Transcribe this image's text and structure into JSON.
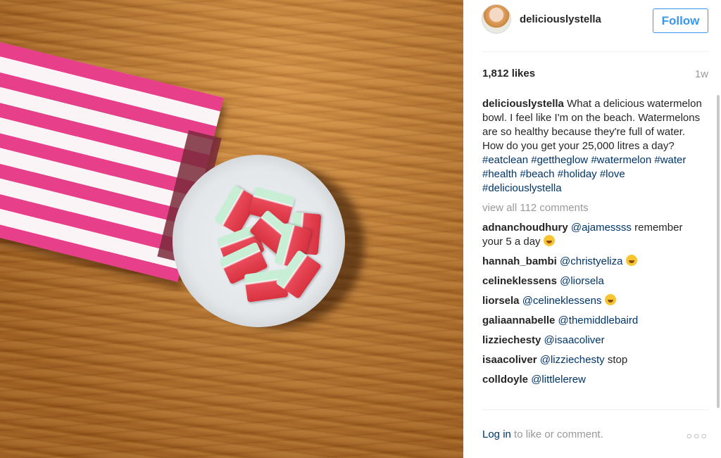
{
  "post": {
    "username": "deliciouslystella",
    "follow_label": "Follow",
    "likes": "1,812 likes",
    "age": "1w"
  },
  "caption": {
    "username": "deliciouslystella",
    "text": "What a delicious watermelon bowl. I feel like I'm on the beach. Watermelons are so healthy because they're full of water. How do you get your 25,000 litres a day?",
    "hashtags": [
      "#eatclean",
      "#gettheglow",
      "#watermelon",
      "#water",
      "#health",
      "#beach",
      "#holiday",
      "#love",
      "#deliciouslystella"
    ]
  },
  "view_all": "view all 112 comments",
  "comments": [
    {
      "user": "adnanchoudhury",
      "mention": "@ajamessss",
      "text": "remember your 5 a day",
      "emoji": "laughing-tears"
    },
    {
      "user": "hannah_bambi",
      "mention": "@christyeliza",
      "text": "",
      "emoji": "laughing-tears"
    },
    {
      "user": "celineklessens",
      "mention": "@liorsela",
      "text": "",
      "emoji": ""
    },
    {
      "user": "liorsela",
      "mention": "@celineklessens",
      "text": "",
      "emoji": "laughing-tears"
    },
    {
      "user": "galiaannabelle",
      "mention": "@themiddlebaird",
      "text": "",
      "emoji": ""
    },
    {
      "user": "lizziechesty",
      "mention": "@isaacoliver",
      "text": "",
      "emoji": ""
    },
    {
      "user": "isaacoliver",
      "mention": "@lizziechesty",
      "text": "stop",
      "emoji": ""
    },
    {
      "user": "colldoyle",
      "mention": "@littlelerew",
      "text": "",
      "emoji": ""
    }
  ],
  "footer": {
    "login_label": "Log in",
    "rest": "to like or comment.",
    "more_icon": "more-options-icon"
  },
  "colors": {
    "accent": "#3897f0",
    "link": "#003569",
    "muted": "#999999"
  }
}
